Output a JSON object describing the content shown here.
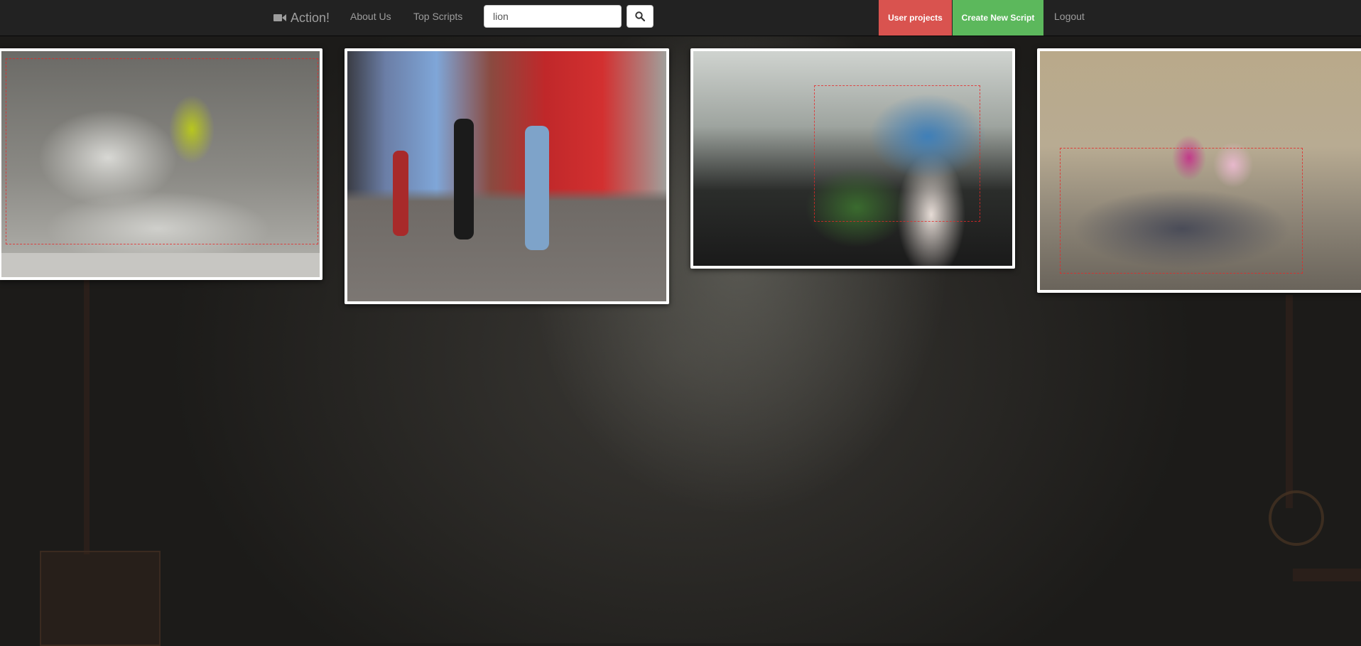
{
  "navbar": {
    "brand": "Action!",
    "links": [
      "About Us",
      "Top Scripts"
    ],
    "search_value": "lion",
    "user_projects": "User projects",
    "create_script": "Create New Script",
    "logout": "Logout"
  },
  "colors": {
    "navbar_bg": "#222222",
    "nav_text": "#9d9d9d",
    "danger": "#d9534f",
    "success": "#5cb85c"
  },
  "results": [
    {
      "subject": "stone lion statue with person"
    },
    {
      "subject": "street scene"
    },
    {
      "subject": "blue lion sculpture with people"
    },
    {
      "subject": "dark lion statue with children"
    }
  ]
}
